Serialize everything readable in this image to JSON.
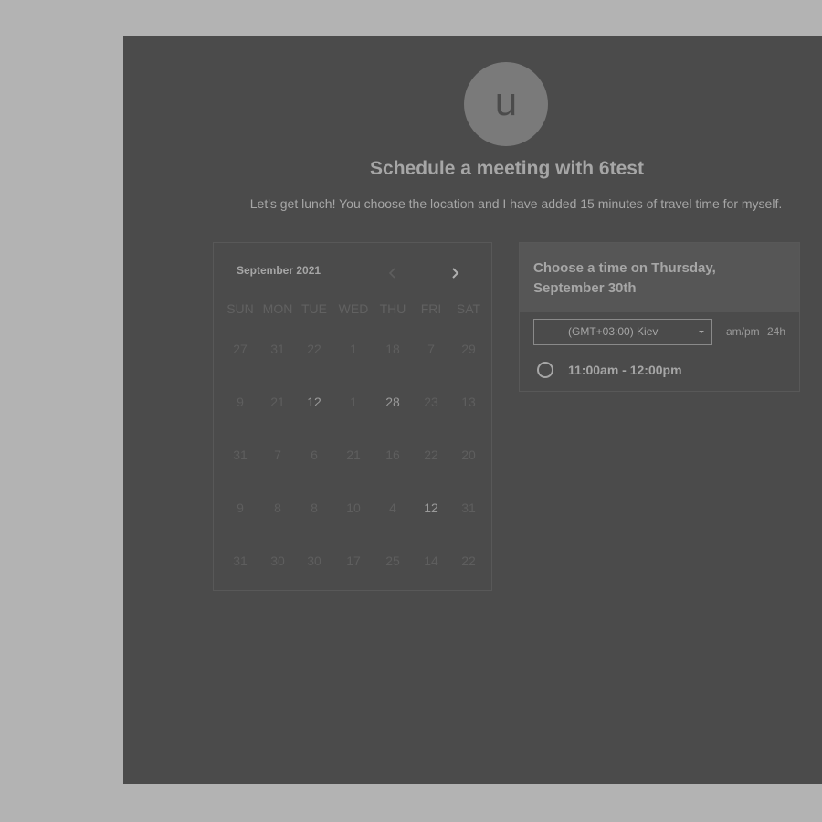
{
  "header": {
    "avatar_letter": "u",
    "title": "Schedule a meeting with 6test",
    "description": "Let's get lunch! You choose the location and I have added 15 minutes of travel time for myself."
  },
  "calendar": {
    "month_label": "September 2021",
    "prev_icon": "chevron-left-icon",
    "next_icon": "chevron-right-icon",
    "weekdays": [
      "SUN",
      "MON",
      "TUE",
      "WED",
      "THU",
      "FRI",
      "SAT"
    ],
    "weeks": [
      [
        "27",
        "31",
        "22",
        "1",
        "18",
        "7",
        "29"
      ],
      [
        "9",
        "21",
        "12",
        "1",
        "28",
        "23",
        "13"
      ],
      [
        "31",
        "7",
        "6",
        "21",
        "16",
        "22",
        "20"
      ],
      [
        "9",
        "8",
        "8",
        "10",
        "4",
        "12",
        "31"
      ],
      [
        "31",
        "30",
        "30",
        "17",
        "25",
        "14",
        "22"
      ]
    ],
    "active_cells": [
      "1-2",
      "1-4",
      "3-5"
    ]
  },
  "slots": {
    "title": "Choose a time on Thursday, September 30th",
    "timezone": "(GMT+03:00) Kiev",
    "format_ampm": "am/pm",
    "format_24h": "24h",
    "items": [
      {
        "label": "11:00am - 12:00pm"
      }
    ]
  },
  "colors": {
    "backdrop": "#b3b3b3",
    "panel": "#4b4b4b",
    "text": "#a6a6a6"
  }
}
